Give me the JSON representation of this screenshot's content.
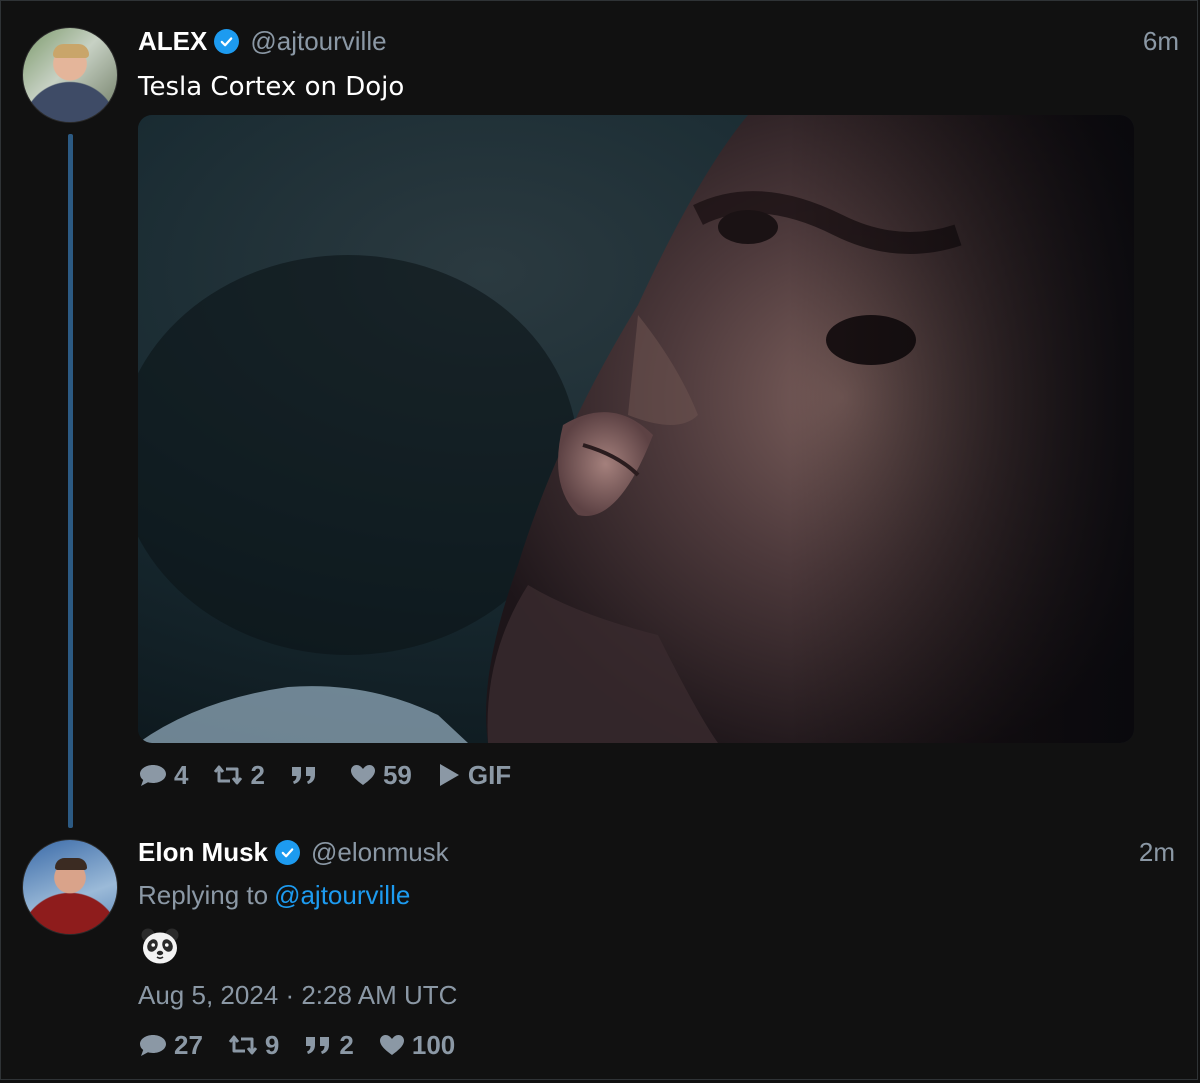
{
  "tweets": [
    {
      "author": {
        "display_name": "ALEX",
        "handle": "@ajtourville",
        "verified": true,
        "avatar": "avatar-alex"
      },
      "time_ago": "6m",
      "text": "Tesla Cortex on Dojo",
      "media": {
        "type": "gif",
        "description_icon": "gif-still-face"
      },
      "stats": {
        "replies": "4",
        "retweets": "2",
        "quotes": "",
        "likes": "59",
        "media_label": "GIF"
      }
    },
    {
      "author": {
        "display_name": "Elon Musk",
        "handle": "@elonmusk",
        "verified": true,
        "avatar": "avatar-elon"
      },
      "time_ago": "2m",
      "replying_prefix": "Replying to",
      "replying_to": "@ajtourville",
      "text_emoji": "panda-face",
      "date": "Aug 5, 2024 · 2:28 AM UTC",
      "stats": {
        "replies": "27",
        "retweets": "9",
        "quotes": "2",
        "likes": "100"
      }
    }
  ],
  "colors": {
    "background": "#111111",
    "accent": "#1d9bf0",
    "muted": "#8b98a5",
    "thread_line": "#2c5a83"
  }
}
